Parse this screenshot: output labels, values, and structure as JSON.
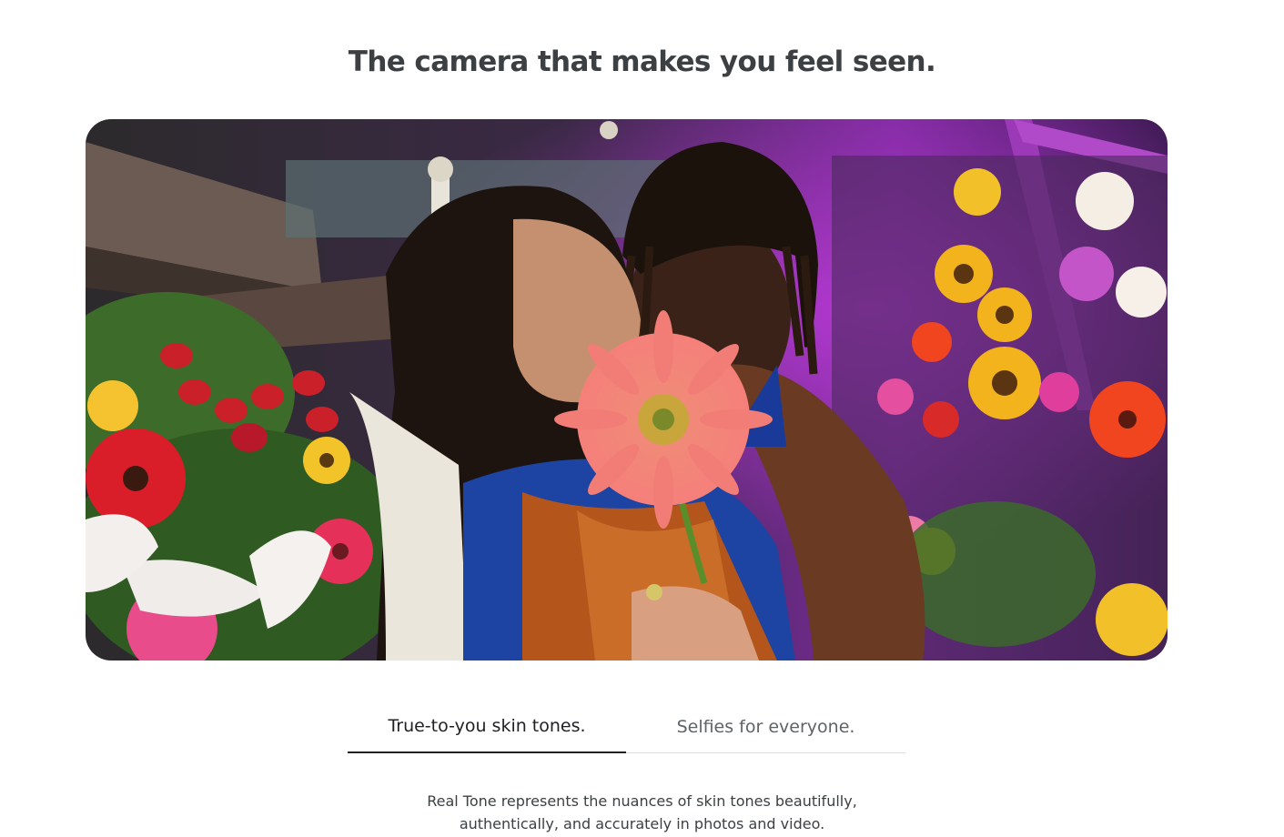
{
  "headline": "The camera that makes you feel seen.",
  "hero": {
    "subject": "two people holding a pink gerbera daisy among colorful flowers"
  },
  "tabs": [
    {
      "label": "True-to-you skin tones.",
      "selected": true
    },
    {
      "label": "Selfies for everyone.",
      "selected": false
    }
  ],
  "description": {
    "line1": "Real Tone represents the nuances of skin tones beautifully,",
    "line2": "authentically, and accurately in photos and video."
  },
  "colors": {
    "headline": "#3c4043",
    "tab_active_underline": "#202124",
    "tab_divider": "#dadce0"
  }
}
